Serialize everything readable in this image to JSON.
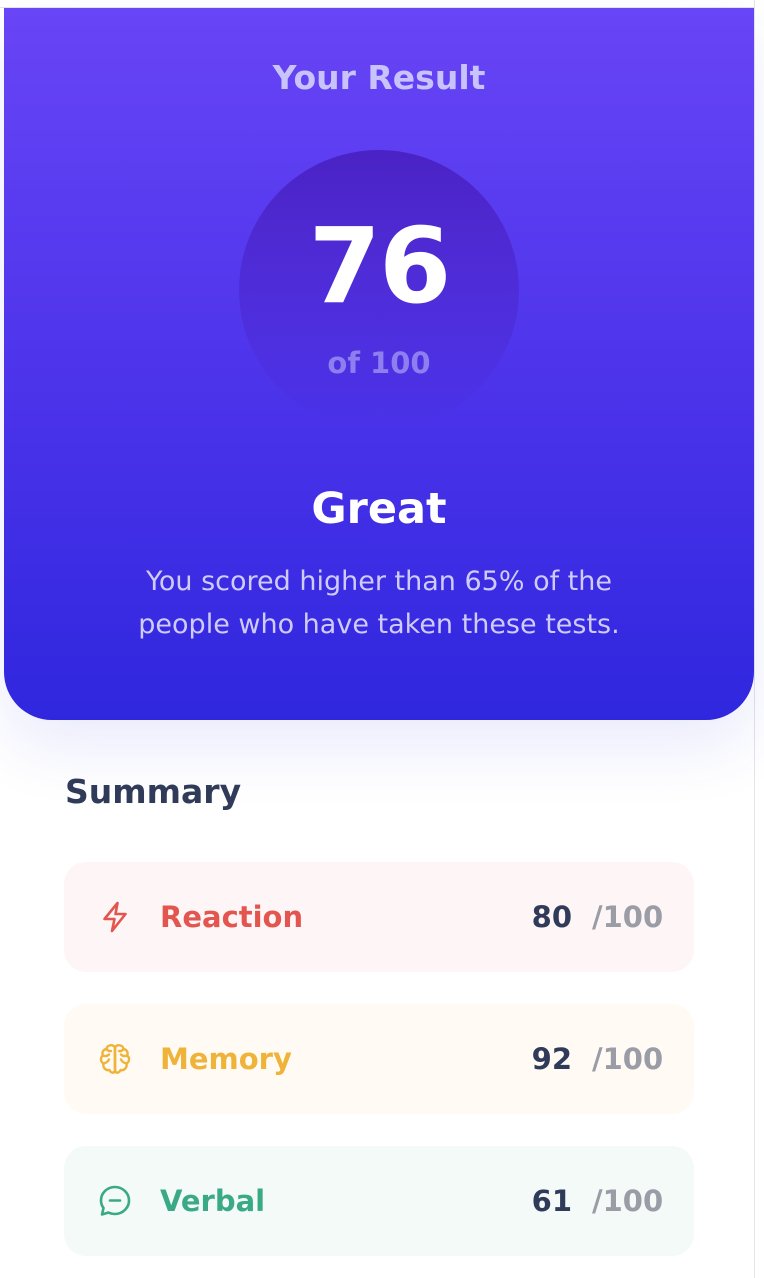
{
  "result": {
    "title": "Your Result",
    "score": "76",
    "max": "of 100",
    "grade": "Great",
    "description": "You scored higher than 65% of the people who have taken these tests."
  },
  "summary": {
    "title": "Summary",
    "items": [
      {
        "label": "Reaction",
        "score": "80",
        "max": "/100",
        "icon": "lightning-icon",
        "color": "#e2564f",
        "background": "#fef6f6"
      },
      {
        "label": "Memory",
        "score": "92",
        "max": "/100",
        "icon": "brain-icon",
        "color": "#efb33a",
        "background": "#fffbf4"
      },
      {
        "label": "Verbal",
        "score": "61",
        "max": "/100",
        "icon": "chat-bubble-icon",
        "color": "#3aa986",
        "background": "#f3faf8"
      }
    ]
  },
  "colors": {
    "gradient_top": "#6845f6",
    "gradient_bottom": "#2f27de",
    "text_dark": "#303b5a"
  }
}
